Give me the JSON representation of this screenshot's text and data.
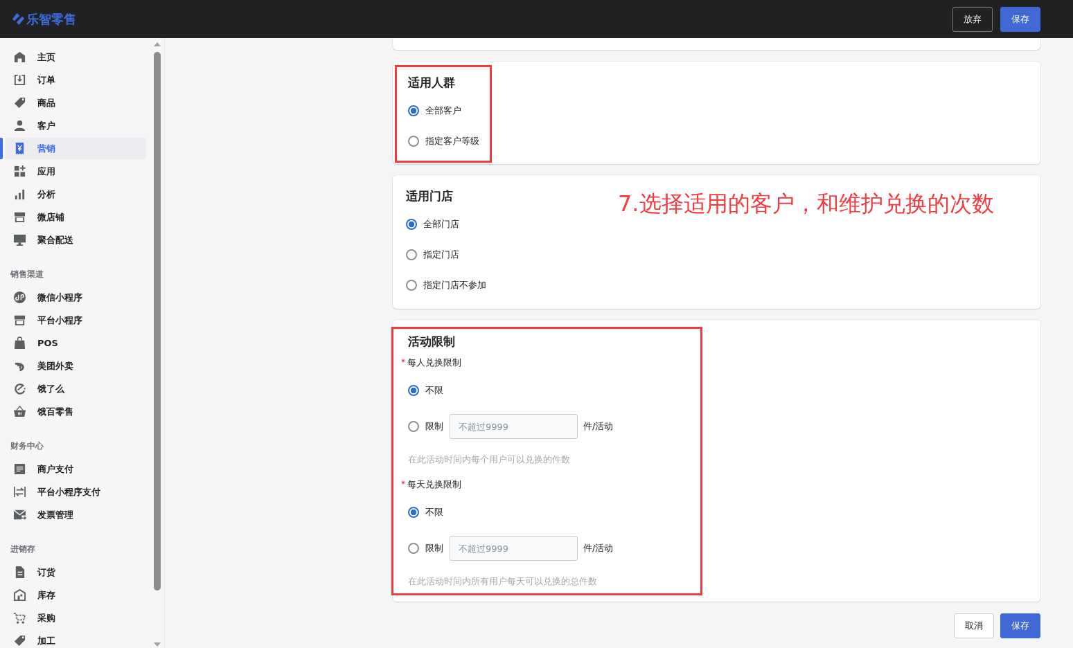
{
  "header": {
    "logo": "乐智零售",
    "buttons": [
      {
        "label": "放弃",
        "kind": "secondary"
      },
      {
        "label": "保存",
        "kind": "primary"
      }
    ]
  },
  "sidebar": {
    "groups": [
      {
        "items": [
          {
            "label": "主页",
            "selected": false
          },
          {
            "label": "订单",
            "selected": false
          },
          {
            "label": "商品",
            "selected": false
          },
          {
            "label": "客户",
            "selected": false
          },
          {
            "label": "营销",
            "selected": true
          },
          {
            "label": "应用",
            "selected": false
          },
          {
            "label": "分析",
            "selected": false
          },
          {
            "label": "微店铺",
            "selected": false
          },
          {
            "label": "聚合配送",
            "selected": false
          }
        ]
      },
      {
        "title": "销售渠道",
        "items": [
          {
            "label": "微信小程序",
            "selected": false
          },
          {
            "label": "平台小程序",
            "selected": false
          },
          {
            "label": "POS",
            "selected": false
          },
          {
            "label": "美团外卖",
            "selected": false
          },
          {
            "label": "饿了么",
            "selected": false
          },
          {
            "label": "饿百零售",
            "selected": false
          }
        ]
      },
      {
        "title": "财务中心",
        "items": [
          {
            "label": "商户支付",
            "selected": false
          },
          {
            "label": "平台小程序支付",
            "selected": false
          },
          {
            "label": "发票管理",
            "selected": false
          }
        ]
      },
      {
        "title": "进销存",
        "items": [
          {
            "label": "订货",
            "selected": false
          },
          {
            "label": "库存",
            "selected": false
          },
          {
            "label": "采购",
            "selected": false
          },
          {
            "label": "加工",
            "selected": false
          }
        ]
      }
    ]
  },
  "sections": [
    {
      "title": "适用人群",
      "highlighted": true,
      "fields": [
        {
          "kind": "radios",
          "options": [
            {
              "label": "全部客户",
              "selected": true
            },
            {
              "label": "指定客户等级",
              "selected": false
            }
          ]
        }
      ]
    },
    {
      "title": "适用门店",
      "highlighted": false,
      "annotation": "7.选择适用的客户，和维护兑换的次数",
      "fields": [
        {
          "kind": "radios",
          "options": [
            {
              "label": "全部门店",
              "selected": true
            },
            {
              "label": "指定门店",
              "selected": false
            },
            {
              "label": "指定门店不参加",
              "selected": false
            }
          ]
        }
      ]
    },
    {
      "title": "活动限制",
      "highlighted": true,
      "fields": [
        {
          "kind": "limit",
          "label": "每人兑换限制",
          "required": true,
          "options": [
            {
              "label": "不限",
              "selected": true
            },
            {
              "label": "限制",
              "selected": false,
              "placeholder": "不超过9999",
              "unit": "件/活动"
            }
          ],
          "help": "在此活动时间内每个用户可以兑换的件数"
        },
        {
          "kind": "limit",
          "label": "每天兑换限制",
          "required": true,
          "options": [
            {
              "label": "不限",
              "selected": true
            },
            {
              "label": "限制",
              "selected": false,
              "placeholder": "不超过9999",
              "unit": "件/活动"
            }
          ],
          "help": "在此活动时间内所有用户每天可以兑换的总件数"
        }
      ]
    }
  ],
  "footer": {
    "buttons": [
      {
        "label": "取消",
        "kind": "secondary"
      },
      {
        "label": "保存",
        "kind": "primary"
      }
    ]
  }
}
